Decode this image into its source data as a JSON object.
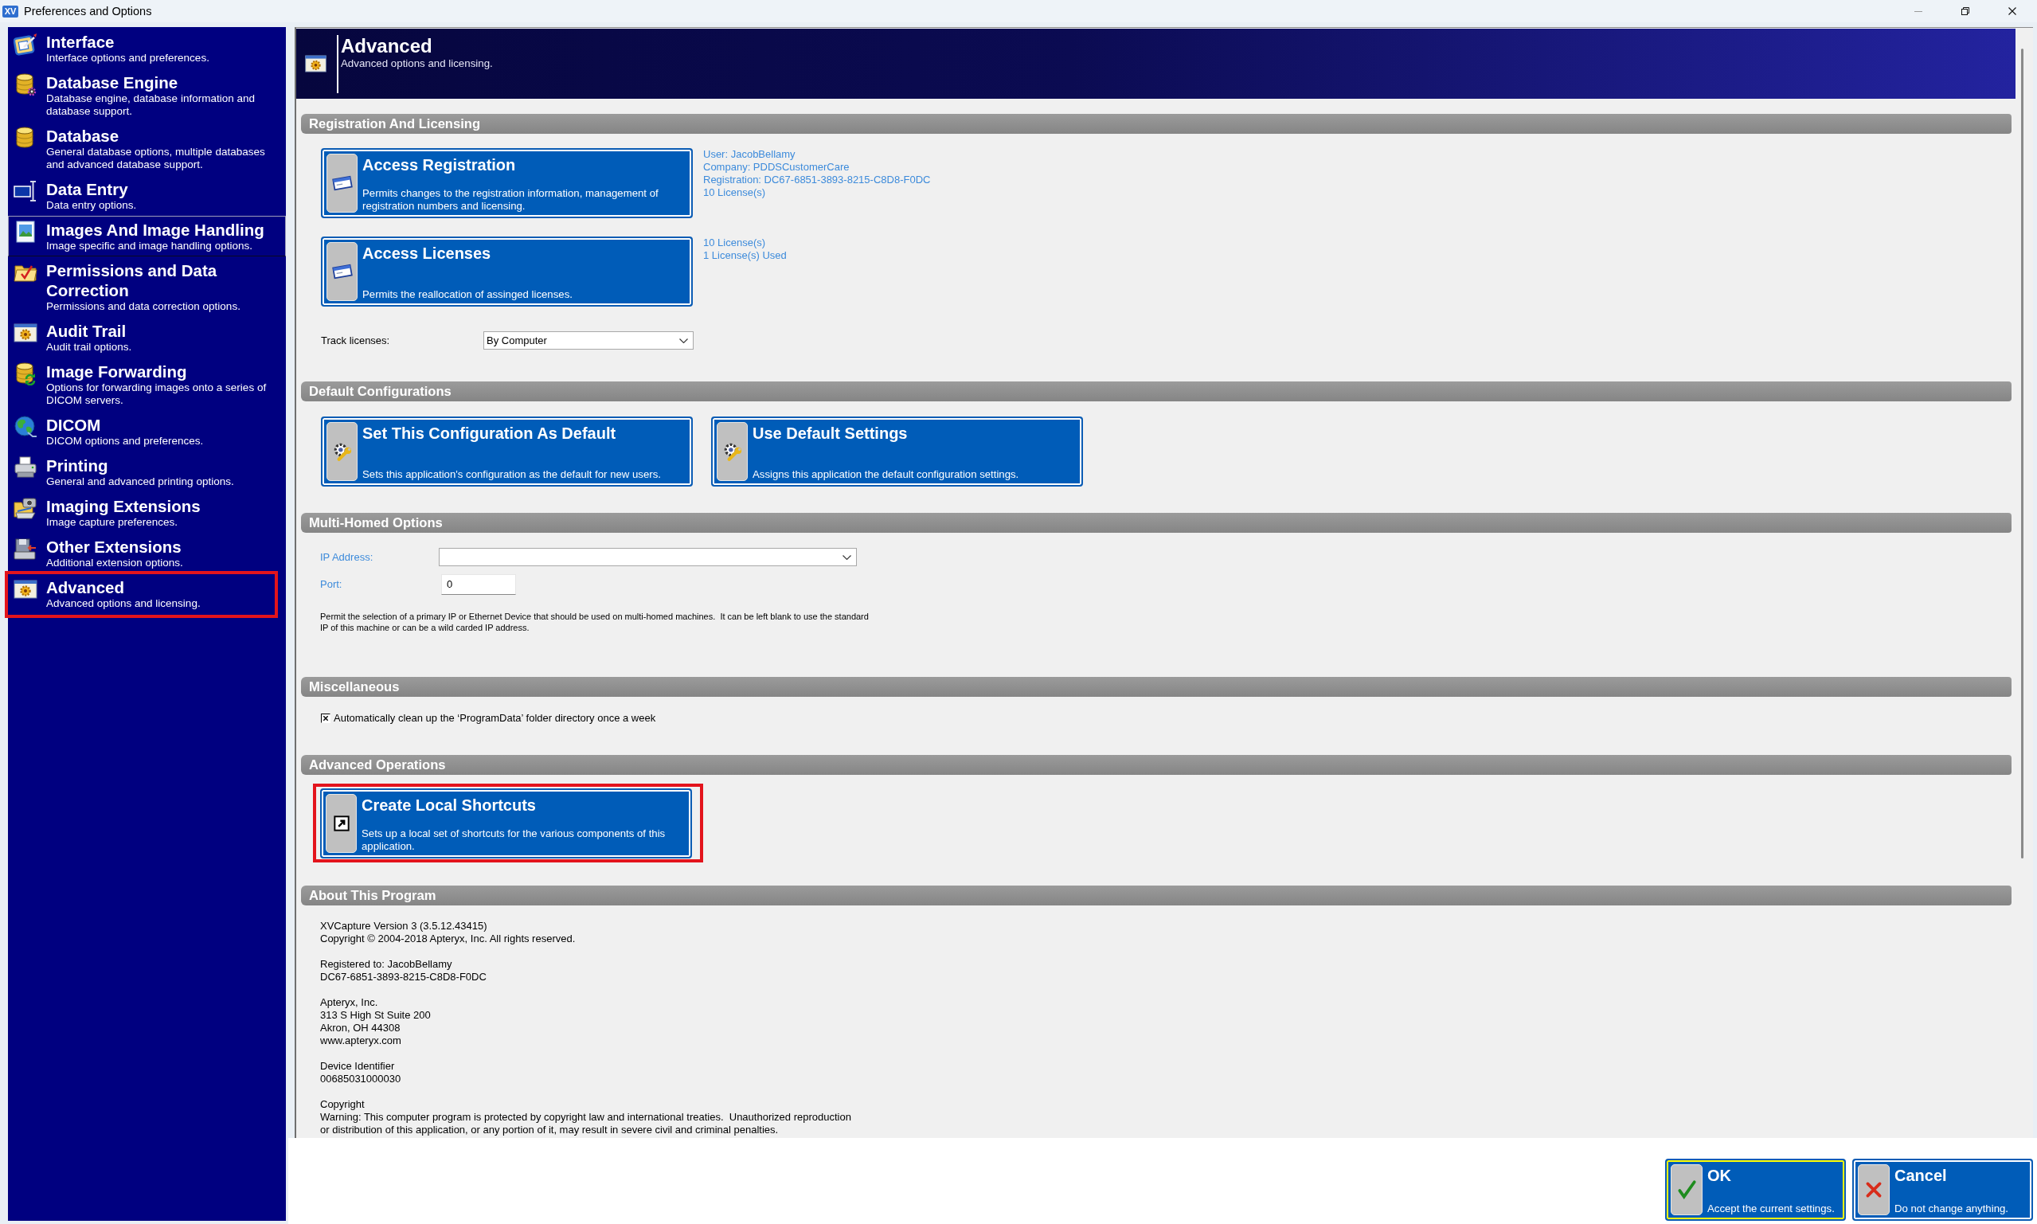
{
  "window": {
    "logo_text": "XV",
    "title": "Preferences and Options"
  },
  "sidebar": {
    "items": [
      {
        "title": "Interface",
        "description": "Interface options and preferences.",
        "hovered": false,
        "highlighted": false
      },
      {
        "title": "Database Engine",
        "description": "Database engine, database information and database support.",
        "hovered": false,
        "highlighted": false
      },
      {
        "title": "Database",
        "description": "General database options, multiple databases and advanced database support.",
        "hovered": false,
        "highlighted": false
      },
      {
        "title": "Data Entry",
        "description": "Data entry options.",
        "hovered": false,
        "highlighted": false
      },
      {
        "title": "Images And Image Handling",
        "description": "Image specific and image handling options.",
        "hovered": true,
        "highlighted": false
      },
      {
        "title": "Permissions and Data Correction",
        "description": "Permissions and data correction options.",
        "hovered": false,
        "highlighted": false
      },
      {
        "title": "Audit Trail",
        "description": "Audit trail options.",
        "hovered": false,
        "highlighted": false
      },
      {
        "title": "Image Forwarding",
        "description": "Options for forwarding images onto a series of DICOM servers.",
        "hovered": false,
        "highlighted": false
      },
      {
        "title": "DICOM",
        "description": "DICOM options and preferences.",
        "hovered": false,
        "highlighted": false
      },
      {
        "title": "Printing",
        "description": "General and advanced printing options.",
        "hovered": false,
        "highlighted": false
      },
      {
        "title": "Imaging Extensions",
        "description": "Image capture preferences.",
        "hovered": false,
        "highlighted": false
      },
      {
        "title": "Other Extensions",
        "description": "Additional extension options.",
        "hovered": false,
        "highlighted": false
      },
      {
        "title": "Advanced",
        "description": "Advanced options and licensing.",
        "hovered": false,
        "highlighted": true
      }
    ]
  },
  "content": {
    "header": {
      "title": "Advanced",
      "subtitle": "Advanced options and licensing."
    },
    "sections": [
      {
        "kind": "licensing",
        "title": "Registration And Licensing",
        "actions": [
          {
            "title": "Access Registration",
            "description": "Permits changes to the registration information, management of registration numbers and licensing.",
            "highlighted": false,
            "info": [
              "User: JacobBellamy",
              "Company: PDDSCustomerCare",
              "Registration: DC67-6851-3893-8215-C8D8-F0DC",
              "10 License(s)"
            ]
          },
          {
            "title": "Access Licenses",
            "description": "Permits the reallocation of assinged licenses.",
            "highlighted": false,
            "info": [
              "10 License(s)",
              "1 License(s) Used"
            ]
          }
        ],
        "fields": [
          {
            "kind": "select",
            "label": "Track licenses:",
            "value": "By Computer"
          }
        ]
      },
      {
        "kind": "configurations",
        "title": "Default Configurations",
        "actions": [
          {
            "title": "Set This Configuration As Default",
            "description": "Sets this application's configuration as the default for new users.",
            "highlighted": false
          },
          {
            "title": "Use Default Settings",
            "description": "Assigns this application the default configuration settings.",
            "highlighted": false
          }
        ]
      },
      {
        "kind": "network",
        "title": "Multi-Homed Options",
        "fields": [
          {
            "kind": "select",
            "label": "IP Address:"
          },
          {
            "kind": "text",
            "label": "Port:",
            "value": "0"
          }
        ],
        "note": "Permit the selection of a primary IP or Ethernet Device that should be used on multi-homed machines.  It can be left blank to use the standard\nIP of this machine or can be a wild carded IP address."
      },
      {
        "kind": "options",
        "title": "Miscellaneous",
        "checkboxes": [
          {
            "label": "Automatically clean up the ‘ProgramData’ folder directory once a week",
            "checked": true
          }
        ]
      },
      {
        "kind": "operations",
        "title": "Advanced Operations",
        "actions": [
          {
            "title": "Create Local Shortcuts",
            "description": "Sets up a local set of shortcuts for the various components of this application.",
            "highlighted": true
          }
        ]
      },
      {
        "kind": "about",
        "title": "About This Program",
        "paragraphs": [
          [
            "XVCapture Version 3 (3.5.12.43415)",
            "Copyright © 2004-2018 Apteryx, Inc. All rights reserved."
          ],
          [
            "Registered to: JacobBellamy",
            "DC67-6851-3893-8215-C8D8-F0DC"
          ],
          [
            "Apteryx, Inc.",
            "313 S High St Suite 200",
            "Akron, OH 44308",
            "www.apteryx.com"
          ],
          [
            "Device Identifier",
            "00685031000030"
          ],
          [
            "Copyright",
            "Warning: This computer program is protected by copyright law and international treaties.  Unauthorized reproduction\nor distribution of this application, or any portion of it, may result in severe civil and criminal penalties."
          ]
        ]
      }
    ]
  },
  "footer": {
    "buttons": [
      {
        "title": "OK",
        "description": "Accept the current settings.",
        "default": true
      },
      {
        "title": "Cancel",
        "description": "Do not change anything.",
        "default": false
      }
    ]
  }
}
